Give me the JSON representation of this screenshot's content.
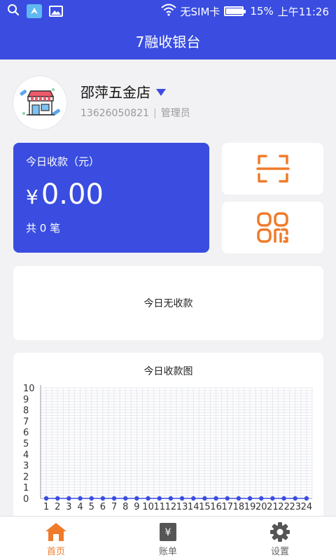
{
  "status_bar": {
    "carrier": "无SIM卡",
    "battery_percent": "15%",
    "battery_level": 0.15,
    "time": "上午11:26",
    "icons": [
      "search-icon",
      "app-notification-icon",
      "image-icon",
      "wifi-icon",
      "battery-icon"
    ]
  },
  "header": {
    "title": "7融收银台"
  },
  "store": {
    "name": "邵萍五金店",
    "phone": "13626050821",
    "separator": "|",
    "role": "管理员"
  },
  "income": {
    "label": "今日收款（元）",
    "currency": "¥",
    "amount": "0.00",
    "count": "共 0 笔"
  },
  "actions": {
    "scan_icon": "scan-icon",
    "qrcode_icon": "qrcode-icon"
  },
  "empty_notice": "今日无收款",
  "colors": {
    "primary": "#3a4de0",
    "accent": "#ef7b2a",
    "chart_point": "#3a4de0"
  },
  "chart_data": {
    "type": "line",
    "title": "今日收款图",
    "x": [
      "1",
      "2",
      "3",
      "4",
      "5",
      "6",
      "7",
      "8",
      "9",
      "10",
      "11",
      "12",
      "13",
      "14",
      "15",
      "16",
      "17",
      "18",
      "19",
      "20",
      "21",
      "22",
      "23",
      "24"
    ],
    "series": [
      {
        "values": [
          0,
          0,
          0,
          0,
          0,
          0,
          0,
          0,
          0,
          0,
          0,
          0,
          0,
          0,
          0,
          0,
          0,
          0,
          0,
          0,
          0,
          0,
          0,
          0
        ]
      }
    ],
    "yticks": [
      "0",
      "1",
      "2",
      "3",
      "4",
      "5",
      "6",
      "7",
      "8",
      "9",
      "10"
    ],
    "ylim": [
      0,
      10
    ],
    "grid": true
  },
  "tabs": [
    {
      "label": "首页",
      "icon": "home-icon",
      "active": true
    },
    {
      "label": "账单",
      "icon": "bill-icon",
      "active": false
    },
    {
      "label": "设置",
      "icon": "gear-icon",
      "active": false
    }
  ]
}
